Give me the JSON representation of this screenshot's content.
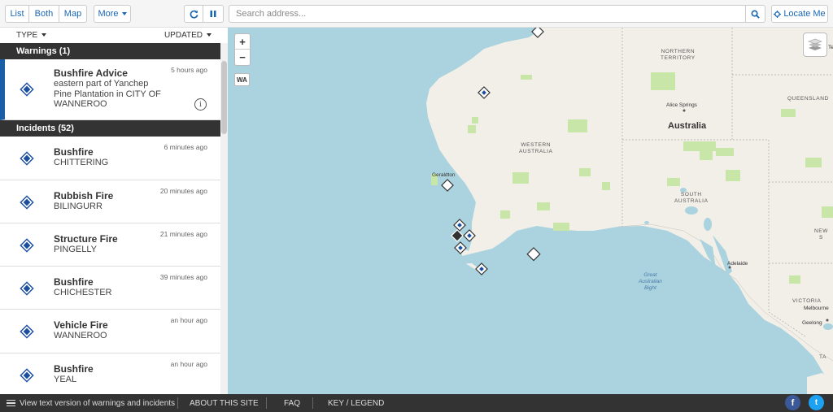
{
  "toolbar": {
    "list_label": "List",
    "both_label": "Both",
    "map_label": "Map",
    "more_label": "More",
    "search_placeholder": "Search address...",
    "locate_label": "Locate Me",
    "icons": [
      "refresh-icon",
      "pause-icon",
      "search-icon",
      "crosshair-icon"
    ]
  },
  "sort": {
    "type_label": "TYPE",
    "updated_label": "UPDATED"
  },
  "warnings": {
    "header": "Warnings (1)",
    "items": [
      {
        "title": "Bushfire Advice",
        "subtitle_lines": [
          "eastern part of Yanchep",
          "Pine Plantation in CITY OF",
          "WANNEROO"
        ],
        "time": "5 hours ago"
      }
    ]
  },
  "incidents": {
    "header": "Incidents (52)",
    "items": [
      {
        "title": "Bushfire",
        "location": "CHITTERING",
        "time": "6 minutes ago"
      },
      {
        "title": "Rubbish Fire",
        "location": "BILINGURR",
        "time": "20 minutes ago"
      },
      {
        "title": "Structure Fire",
        "location": "PINGELLY",
        "time": "21 minutes ago"
      },
      {
        "title": "Bushfire",
        "location": "CHICHESTER",
        "time": "39 minutes ago"
      },
      {
        "title": "Vehicle Fire",
        "location": "WANNEROO",
        "time": "an hour ago"
      },
      {
        "title": "Bushfire",
        "location": "YEAL",
        "time": "an hour ago"
      }
    ]
  },
  "map": {
    "zoom_in": "+",
    "zoom_out": "−",
    "state_button": "WA",
    "labels": {
      "northern_territory": [
        "NORTHERN",
        "TERRITORY"
      ],
      "queensland": "QUEENSLAND",
      "western_australia": [
        "WESTERN",
        "AUSTRALIA"
      ],
      "south_australia": [
        "SOUTH",
        "AUSTRALIA"
      ],
      "australia": "Australia",
      "alice_springs": "Alice Springs",
      "geraldton": "Geraldton",
      "adelaide": "Adelaide",
      "melbourne": "Melbourne",
      "geelong": "Geelong",
      "victoria": "VICTORIA",
      "new_s": [
        "NEW",
        "S"
      ],
      "great_australian_bight": [
        "Great",
        "Australian",
        "Bight"
      ],
      "ta": "TA",
      "te": "Te"
    },
    "colors": {
      "ocean": "#aad3df",
      "land": "#f2efe9",
      "park": "#c8e6a8",
      "border": "#b0a8a0"
    }
  },
  "footer": {
    "text_version": "View text version of warnings and incidents",
    "about": "ABOUT THIS SITE",
    "faq": "FAQ",
    "legend": "KEY / LEGEND",
    "facebook": "f",
    "twitter": "t"
  },
  "colors": {
    "accent": "#1a66b3",
    "warning_bar": "#1a5ea8",
    "header_dark": "#333333",
    "icon_blue": "#1a4fa0"
  }
}
